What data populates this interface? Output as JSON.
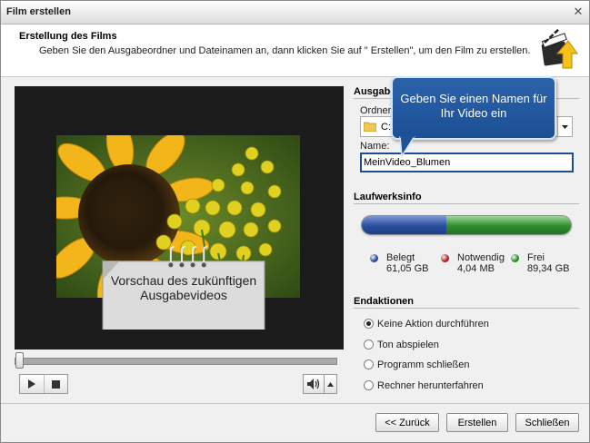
{
  "window": {
    "title": "Film erstellen"
  },
  "header": {
    "title": "Erstellung des Films",
    "description": "Geben Sie den Ausgabeordner und Dateinamen an, dann klicken Sie auf \" Erstellen\", um den Film zu erstellen."
  },
  "preview": {
    "note": "Vorschau des zukünftigen Ausgabevideos",
    "seek_position": 0
  },
  "output": {
    "section_title": "Ausgabe",
    "folder_label": "Ordner:",
    "folder_value": "C:\\",
    "name_label": "Name:",
    "name_value": "MeinVideo_Blumen",
    "tooltip": "Geben Sie einen Namen für Ihr Video ein"
  },
  "drive": {
    "section_title": "Laufwerksinfo",
    "used_fraction": 0.406,
    "legend": [
      {
        "label": "Belegt",
        "value": "61,05 GB",
        "color": "#1f3f9a"
      },
      {
        "label": "Notwendig",
        "value": "4,04 MB",
        "color": "#b01818"
      },
      {
        "label": "Frei",
        "value": "89,34 GB",
        "color": "#1f8a1f"
      }
    ]
  },
  "end_actions": {
    "section_title": "Endaktionen",
    "options": [
      {
        "label": "Keine Aktion durchführen",
        "checked": true
      },
      {
        "label": "Ton abspielen",
        "checked": false
      },
      {
        "label": "Programm schließen",
        "checked": false
      },
      {
        "label": "Rechner herunterfahren",
        "checked": false
      }
    ]
  },
  "buttons": {
    "back": "<< Zurück",
    "create": "Erstellen",
    "close": "Schließen"
  },
  "colors": {
    "accent": "#1f4e8f",
    "tooltip_bg": "#2360a8",
    "used": "#2a4e9d",
    "free": "#2f8d2e"
  }
}
